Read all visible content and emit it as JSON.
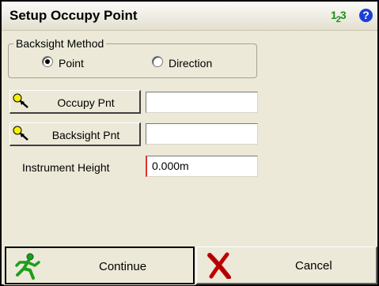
{
  "title": "Setup Occupy Point",
  "title_icons": {
    "numeric": {
      "main": "1",
      "sub": "2",
      "tail": "3"
    },
    "help": "?"
  },
  "backsight_method": {
    "legend": "Backsight Method",
    "options": [
      {
        "label": "Point",
        "selected": true
      },
      {
        "label": "Direction",
        "selected": false
      }
    ]
  },
  "occupy": {
    "button_label": "Occupy Pnt",
    "value": ""
  },
  "backsight": {
    "button_label": "Backsight Pnt",
    "value": ""
  },
  "instrument_height": {
    "label": "Instrument Height",
    "value": "0.000m"
  },
  "buttons": {
    "continue": "Continue",
    "cancel": "Cancel"
  },
  "colors": {
    "window_bg": "#ece9d8",
    "numeric_icon": "#1a8f1a",
    "help_icon": "#1c3fd6",
    "cancel_icon": "#c00000",
    "continue_icon": "#1e9e1e",
    "pick_icon": "#f4f000"
  },
  "icons": {
    "pick": "point-pick-icon",
    "continue": "running-man-icon",
    "cancel": "red-x-icon"
  }
}
